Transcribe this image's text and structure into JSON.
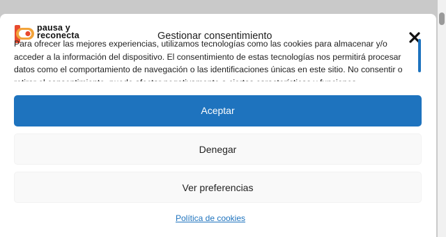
{
  "brand": {
    "line1": "pausa y",
    "line2": "reconecta",
    "accent": "#e84a2e"
  },
  "dialog": {
    "title": "Gestionar consentimiento",
    "message": "Para ofrecer las mejores experiencias, utilizamos tecnologías como las cookies para almacenar y/o acceder a la información del dispositivo. El consentimiento de estas tecnologías nos permitirá procesar datos como el comportamiento de navegación o las identificaciones únicas en este sitio. No consentir o retirar el consentimiento, puede afectar negativamente a ciertas características y funciones.",
    "close_icon": "close-icon"
  },
  "buttons": {
    "accept": "Aceptar",
    "deny": "Denegar",
    "preferences": "Ver preferencias"
  },
  "links": {
    "policy": "Política de cookies"
  },
  "colors": {
    "primary": "#1e73be",
    "secondary_bg": "#f9f9f9"
  }
}
